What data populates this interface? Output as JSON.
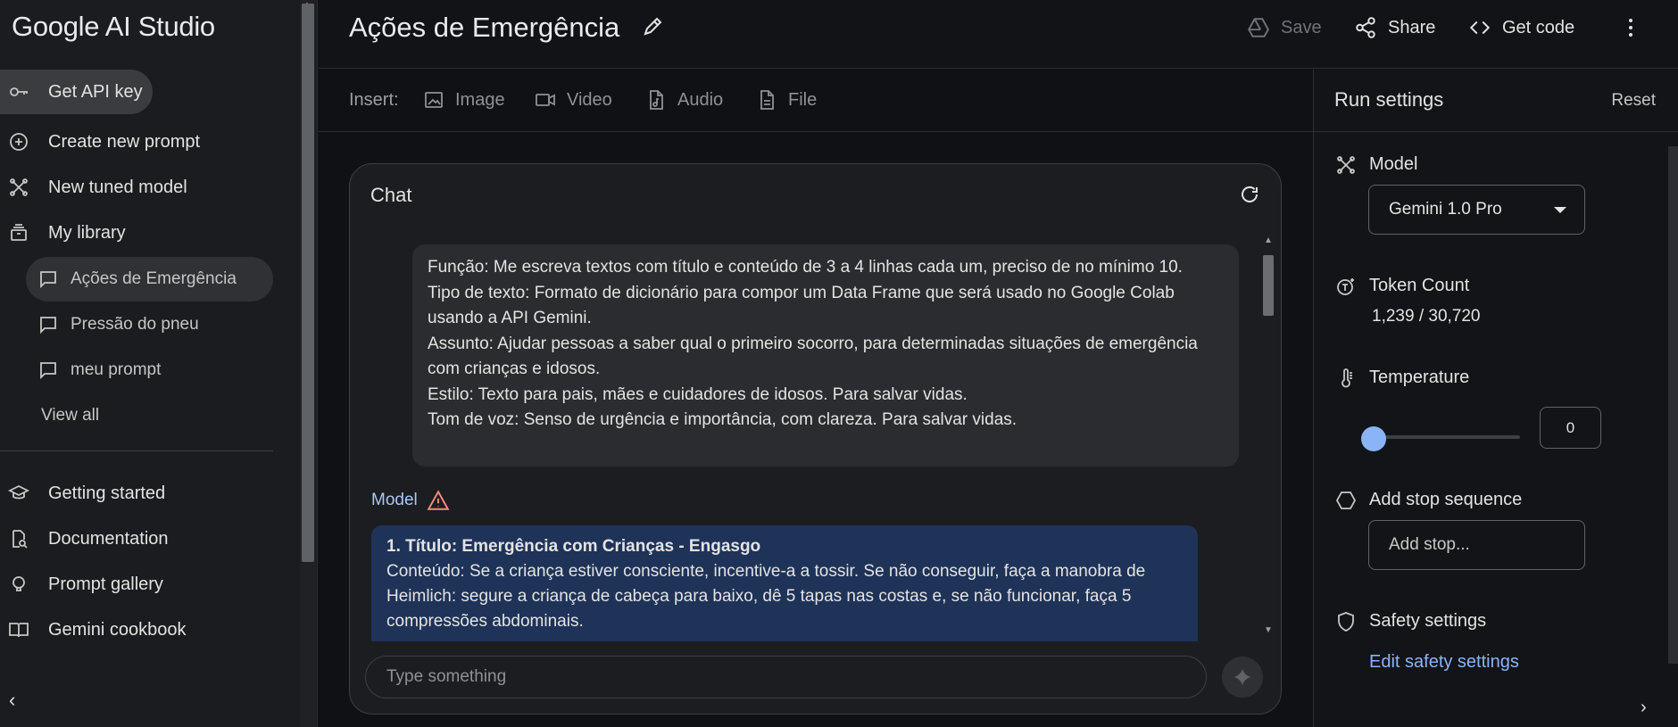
{
  "app": {
    "brand": "Google AI Studio"
  },
  "sidebar": {
    "api_key": "Get API key",
    "items": [
      {
        "label": "Create new prompt",
        "icon": "plus-circle-icon"
      },
      {
        "label": "New tuned model",
        "icon": "tune-icon"
      },
      {
        "label": "My library",
        "icon": "library-icon"
      }
    ],
    "library": [
      {
        "label": "Ações de Emergência",
        "active": true
      },
      {
        "label": "Pressão do pneu",
        "active": false
      },
      {
        "label": "meu prompt",
        "active": false
      }
    ],
    "view_all": "View all",
    "bottom": [
      {
        "label": "Getting started",
        "icon": "graduation-cap-icon"
      },
      {
        "label": "Documentation",
        "icon": "document-search-icon"
      },
      {
        "label": "Prompt gallery",
        "icon": "lightbulb-icon"
      },
      {
        "label": "Gemini cookbook",
        "icon": "book-icon"
      }
    ]
  },
  "header": {
    "title": "Ações de Emergência",
    "save": "Save",
    "share": "Share",
    "get_code": "Get code"
  },
  "insert": {
    "label": "Insert:",
    "image": "Image",
    "video": "Video",
    "audio": "Audio",
    "file": "File"
  },
  "chat": {
    "title": "Chat",
    "user_message": [
      "Função: Me escreva textos com título e conteúdo de 3 a 4 linhas cada um, preciso de no mínimo 10.",
      "Tipo de texto: Formato de dicionário para compor um Data Frame que será usado no Google Colab usando a API Gemini.",
      "Assunto: Ajudar pessoas a saber qual o primeiro socorro, para determinadas situações de emergência com crianças e idosos.",
      "Estilo: Texto para pais, mães e cuidadores de idosos. Para salvar vidas.",
      "Tom de voz: Senso de urgência e importância, com clareza. Para salvar vidas."
    ],
    "model_label": "Model",
    "model_heading": "1. Título: Emergência com Crianças - Engasgo",
    "model_body": "Conteúdo: Se a criança estiver consciente, incentive-a a tossir. Se não conseguir, faça a manobra de Heimlich: segure a criança de cabeça para baixo, dê 5 tapas nas costas e, se não funcionar, faça 5 compressões abdominais.",
    "input_placeholder": "Type something"
  },
  "run_settings": {
    "title": "Run settings",
    "reset": "Reset",
    "model_label": "Model",
    "model_value": "Gemini 1.0 Pro",
    "token_label": "Token Count",
    "token_value": "1,239 / 30,720",
    "temperature_label": "Temperature",
    "temperature_value": "0",
    "temperature_fraction": 0,
    "stop_label": "Add stop sequence",
    "stop_placeholder": "Add stop...",
    "safety_label": "Safety settings",
    "safety_link": "Edit safety settings"
  },
  "colors": {
    "accent": "#8ab4f8",
    "model_bubble": "#1f3358",
    "warning": "#f28b82"
  }
}
